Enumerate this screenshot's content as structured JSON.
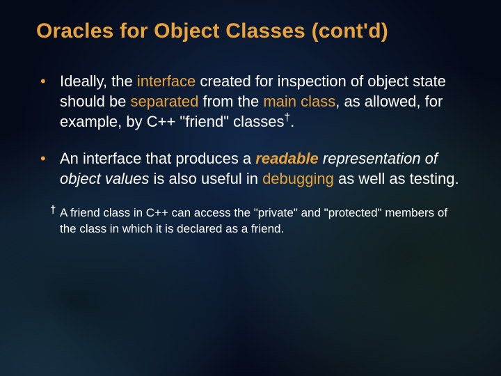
{
  "title": "Oracles for Object Classes (cont'd)",
  "bullet1": {
    "t1": "Ideally, the ",
    "t2": "interface",
    "t3": " created for inspection of object state should be ",
    "t4": "separated",
    "t5": " from the ",
    "t6": "main class",
    "t7": ", as allowed, for example, by C++ \"friend\" classes",
    "dag": "†",
    "t8": "."
  },
  "bullet2": {
    "t1": "An interface that produces a ",
    "t2": "readable",
    "t3": " ",
    "t4": "representation of object values",
    "t5": " is also useful in ",
    "t6": "debugging",
    "t7": " as well as testing."
  },
  "footnote": {
    "mark": "†",
    "text": "A friend class in C++ can access the \"private\" and \"protected\" members of the class in which it is declared as a friend."
  }
}
